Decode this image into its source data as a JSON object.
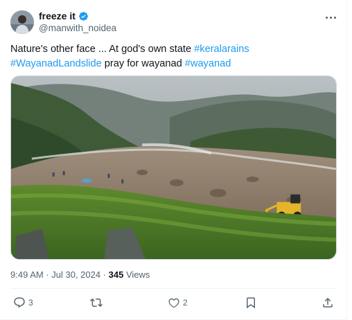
{
  "author": {
    "display_name": "freeze it",
    "handle": "@manwith_noidea"
  },
  "tweet": {
    "text_parts": [
      {
        "text": "Nature's other face ... At god's own state ",
        "hashtag": false
      },
      {
        "text": "#keralarains",
        "hashtag": true
      },
      {
        "text": " ",
        "hashtag": false
      },
      {
        "text": "#WayanadLandslide",
        "hashtag": true
      },
      {
        "text": " pray for wayanad ",
        "hashtag": false
      },
      {
        "text": "#wayanad",
        "hashtag": true
      }
    ]
  },
  "meta": {
    "timestamp": "9:49 AM · Jul 30, 2024 · ",
    "views_count": "345",
    "views_label": " Views"
  },
  "actions": {
    "reply_count": "3",
    "retweet_count": "",
    "like_count": "2"
  },
  "colors": {
    "accent": "#1d9bf0",
    "text_primary": "#0f1419",
    "text_secondary": "#536471"
  }
}
